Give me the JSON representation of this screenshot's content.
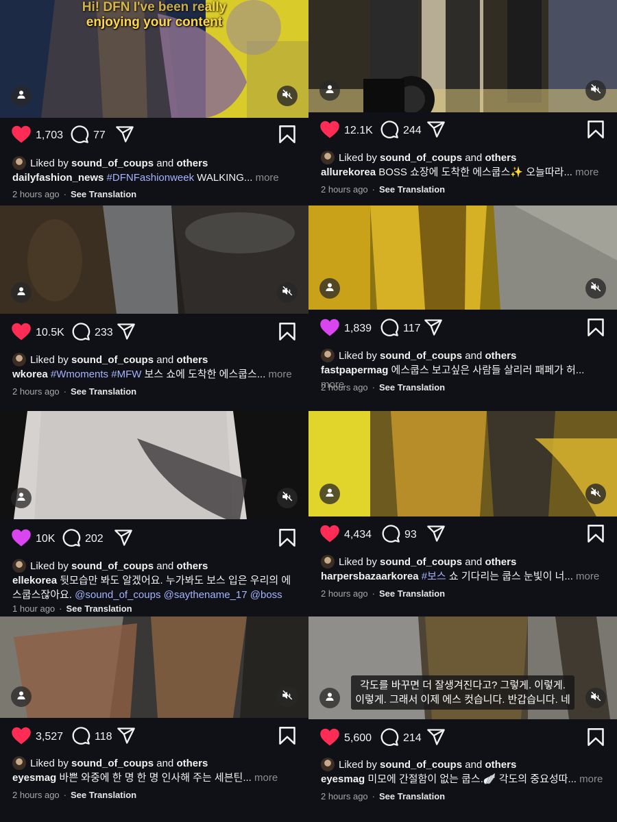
{
  "liked_by": {
    "prefix": "Liked by",
    "user": "sound_of_coups",
    "joiner": "and",
    "others": "others"
  },
  "see_translation": "See Translation",
  "more": "more",
  "colors": {
    "background": "#0f1116",
    "like_red": "#ff2d55",
    "hashtag": "#a6b4ff"
  },
  "icons": {
    "like": "heart-icon",
    "comment": "comment-bubble-icon",
    "share": "paper-plane-icon",
    "save": "bookmark-icon",
    "mute": "muted-speaker-icon",
    "tagged": "person-icon"
  },
  "posts": [
    {
      "likes": "1,703",
      "comments": "77",
      "heart": "red",
      "subtitle": [
        "Hi! DFN I've been really",
        "enjoying your content"
      ],
      "caption_overlay": [],
      "username": "dailyfashion_news",
      "caption": [
        {
          "t": "#DFNFashionweek",
          "tag": true
        },
        {
          "t": " WALKING... ",
          "tag": false
        }
      ],
      "time": "2 hours ago"
    },
    {
      "likes": "12.1K",
      "comments": "244",
      "heart": "red",
      "subtitle": [],
      "caption_overlay": [],
      "username": "allurekorea",
      "caption": [
        {
          "t": "BOSS 쇼장에 도착한 에스쿱스✨ 오늘따라... ",
          "tag": false
        }
      ],
      "time": "2 hours ago"
    },
    {
      "likes": "10.5K",
      "comments": "233",
      "heart": "red",
      "subtitle": [],
      "caption_overlay": [],
      "username": "wkorea",
      "caption": [
        {
          "t": "#Wmoments #MFW",
          "tag": true
        },
        {
          "t": " 보스 쇼에 도착한 에스쿱스... ",
          "tag": false
        }
      ],
      "time": "2 hours ago"
    },
    {
      "likes": "1,839",
      "comments": "117",
      "heart": "pink",
      "subtitle": [],
      "caption_overlay": [],
      "username": "fastpapermag",
      "caption": [
        {
          "t": "에스쿱스 보고싶은 사람들 살리러 패페가 허... ",
          "tag": false
        }
      ],
      "time": "2 hours ago"
    },
    {
      "likes": "10K",
      "comments": "202",
      "heart": "pink",
      "subtitle": [],
      "caption_overlay": [],
      "username": "ellekorea",
      "caption": [
        {
          "t": "뒷모습만 봐도 알겠어요. 누가봐도 보스 입은 우리의 에스쿱스잖아요. ",
          "tag": false
        },
        {
          "t": "@sound_of_coups @saythename_17 @boss",
          "tag": true
        }
      ],
      "time": "1 hour ago"
    },
    {
      "likes": "4,434",
      "comments": "93",
      "heart": "red",
      "subtitle": [],
      "caption_overlay": [],
      "username": "harpersbazaarkorea",
      "caption": [
        {
          "t": "#보스",
          "tag": true
        },
        {
          "t": " 쇼 기다리는 쿱스 눈빛이 너... ",
          "tag": false
        }
      ],
      "time": "2 hours ago"
    },
    {
      "likes": "3,527",
      "comments": "118",
      "heart": "red",
      "subtitle": [],
      "caption_overlay": [],
      "username": "eyesmag",
      "caption": [
        {
          "t": "바쁜 와중에 한 명 한 명 인사해 주는 세븐틴... ",
          "tag": false
        }
      ],
      "time": "2 hours ago"
    },
    {
      "likes": "5,600",
      "comments": "214",
      "heart": "red",
      "subtitle": [],
      "caption_overlay": [
        "각도를 바꾸면 더 잘생겨진다고? 그렇게. 이렇게.",
        "이렇게. 그래서 이제 에스 컷습니다. 반갑습니다. 네"
      ],
      "username": "eyesmag",
      "caption": [
        {
          "t": "미모에 간절함이 없는 쿱스.🪽 각도의 중요성따... ",
          "tag": false
        }
      ],
      "time": "2 hours ago"
    }
  ]
}
